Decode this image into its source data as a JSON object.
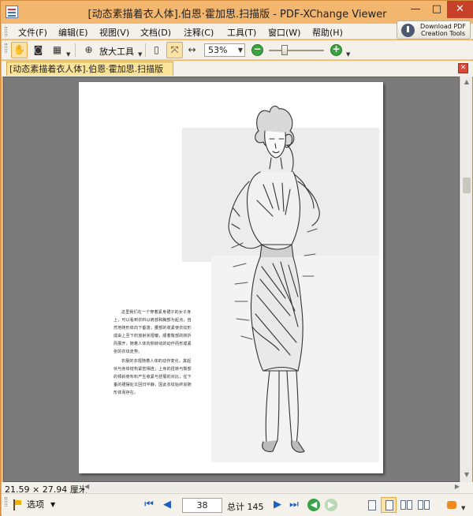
{
  "window": {
    "title": "[动态素描着衣人体].伯恩·霍加思.扫描版 - PDF-XChange Viewer",
    "minimize": "—",
    "maximize": "□",
    "close": "✕"
  },
  "menu": {
    "items": [
      "文件(F)",
      "编辑(E)",
      "视图(V)",
      "文档(D)",
      "注释(C)",
      "工具(T)",
      "窗口(W)",
      "帮助(H)"
    ],
    "download_button": {
      "line1": "Download PDF",
      "line2": "Creation Tools"
    }
  },
  "toolbar": {
    "zoom_tool_label": "放大工具",
    "zoom_value": "53%",
    "zoom_out": "−",
    "zoom_in": "+",
    "slider_level_percent": 25
  },
  "tab": {
    "document_title": "[动态素描着衣人体].伯恩·霍加思.扫描版",
    "close": "✕"
  },
  "page_content": {
    "paragraphs": [
      "这里我们在一个穿着紧身裙子的女子身上，可以看到衣料以肩部和胸部为起点，自然地随形体向下垂落；腰部的收紧使衣纹形成由上至下的放射状褶皱，顺着臀部的转折而展开，随着人体向侧转动的动作而形成紧张的衣纹走势。",
      "衣服的衣褶随着人体的动作变化，其起伏与身体结构紧密相连；上身的扭转与臀部的倾斜使布料产生收紧与舒展的对比，在下垂的裙摆处又回归平静，因此衣纹始终追随形体而存在。"
    ]
  },
  "status": {
    "page_size": "21.59 × 27.94 厘米"
  },
  "navigation": {
    "options_label": "选项",
    "current_page": "38",
    "total_label": "总计 145",
    "first_page": "⏮",
    "prev_page": "◀",
    "next_page": "▶",
    "last_page": "⏭"
  },
  "colors": {
    "title_bar": "#f3b66f",
    "accent_border": "#e3a94d",
    "nav_blue": "#1d5fc4",
    "green_button": "#39a340",
    "close_red": "#c7402a"
  }
}
